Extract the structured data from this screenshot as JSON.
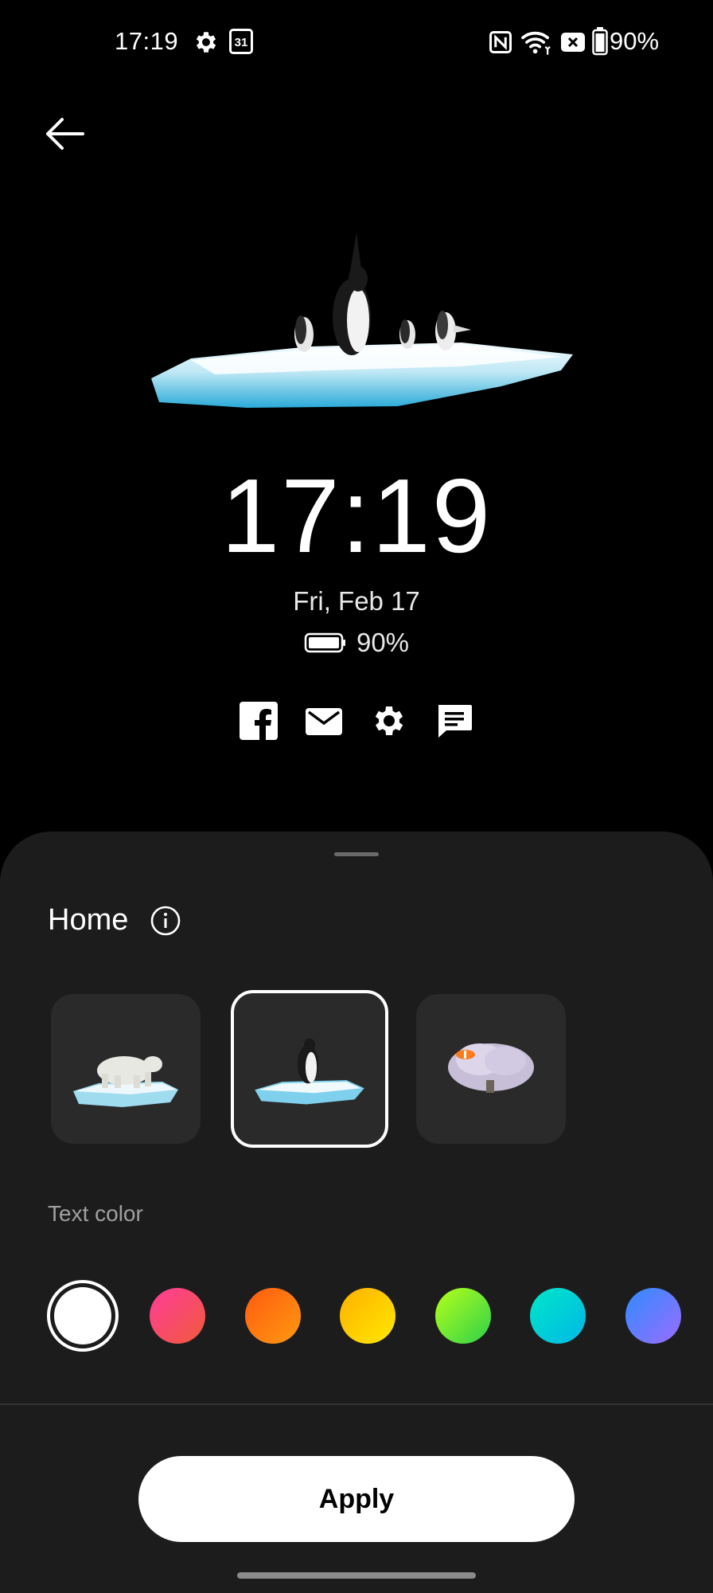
{
  "status_bar": {
    "time": "17:19",
    "calendar_day": "31",
    "battery_percent": "90%",
    "icons": [
      "gear-icon",
      "calendar-icon",
      "nfc-icon",
      "wifi-icon",
      "no-sim-icon",
      "battery-icon"
    ]
  },
  "preview": {
    "clock": "17:19",
    "date": "Fri, Feb 17",
    "battery": "90%",
    "notification_icons": [
      "facebook-icon",
      "mail-icon",
      "settings-icon",
      "message-icon"
    ]
  },
  "sheet": {
    "title": "Home",
    "styles": [
      {
        "name": "polar-bear",
        "selected": false
      },
      {
        "name": "penguin",
        "selected": true
      },
      {
        "name": "coral-reef",
        "selected": false
      }
    ],
    "text_color_label": "Text color",
    "colors": [
      {
        "name": "white",
        "from": "#ffffff",
        "to": "#ffffff",
        "selected": true
      },
      {
        "name": "pink",
        "from": "#ff3c9a",
        "to": "#f05a3a",
        "selected": false
      },
      {
        "name": "orange",
        "from": "#ff5a10",
        "to": "#ff9a10",
        "selected": false
      },
      {
        "name": "yellow",
        "from": "#ffb000",
        "to": "#ffe800",
        "selected": false
      },
      {
        "name": "lime",
        "from": "#b6ff1a",
        "to": "#2ed14a",
        "selected": false
      },
      {
        "name": "teal",
        "from": "#00e6c8",
        "to": "#00b8e6",
        "selected": false
      },
      {
        "name": "blue",
        "from": "#2f8cff",
        "to": "#9a6cff",
        "selected": false
      }
    ],
    "apply_label": "Apply"
  }
}
